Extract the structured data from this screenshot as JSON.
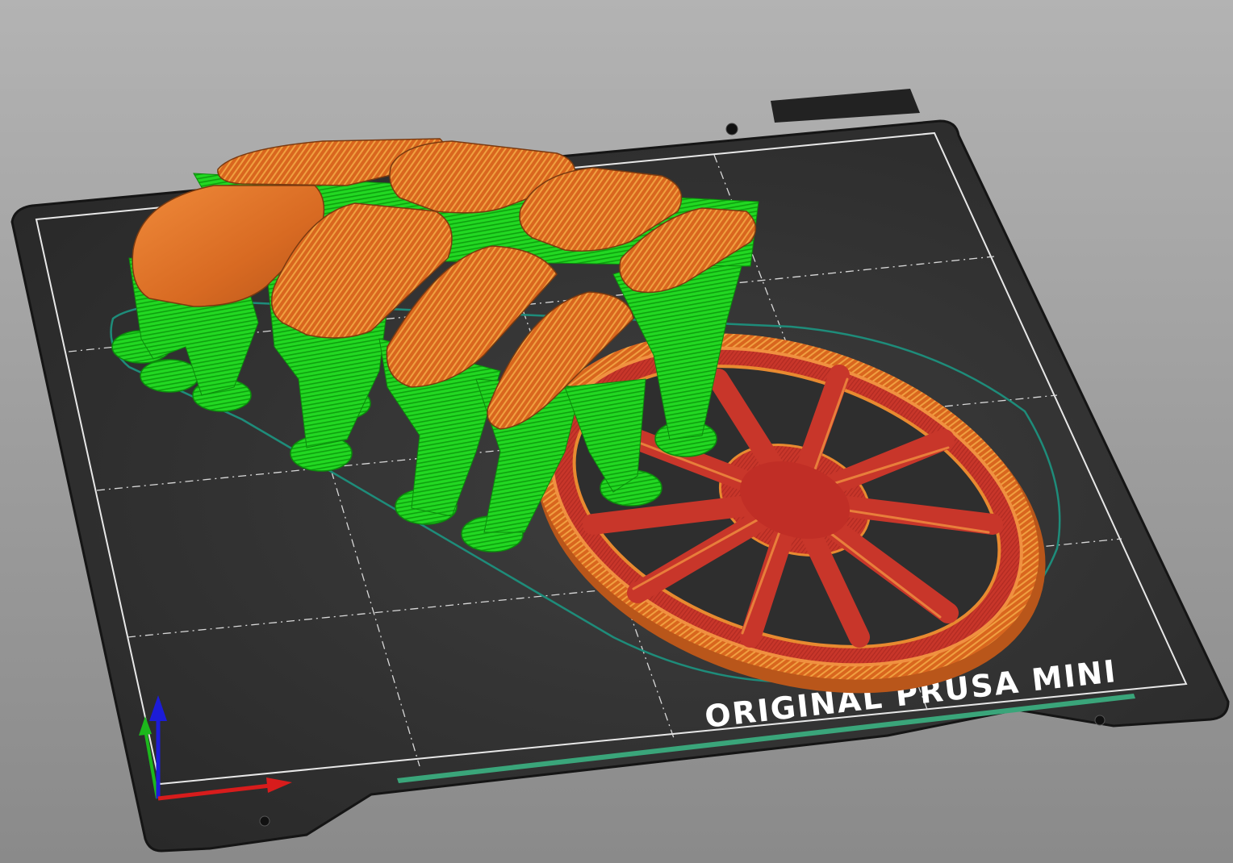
{
  "viewport": {
    "bed_label": "ORIGINAL PRUSA MINI",
    "axes": [
      "x-axis",
      "y-axis",
      "z-axis"
    ],
    "colors": {
      "background_top": "#b3b3b3",
      "bed": "#2f2f2f",
      "bed_edge": "#1a1a1a",
      "grid": "#dcdcdc",
      "support": "#1ee61e",
      "perimeter": "#e07020",
      "infill": "#c8362a",
      "skirt": "#1e8c7a",
      "axis_x": "#d81c1c",
      "axis_y": "#1cb81c",
      "axis_z": "#1c1cd8"
    }
  }
}
